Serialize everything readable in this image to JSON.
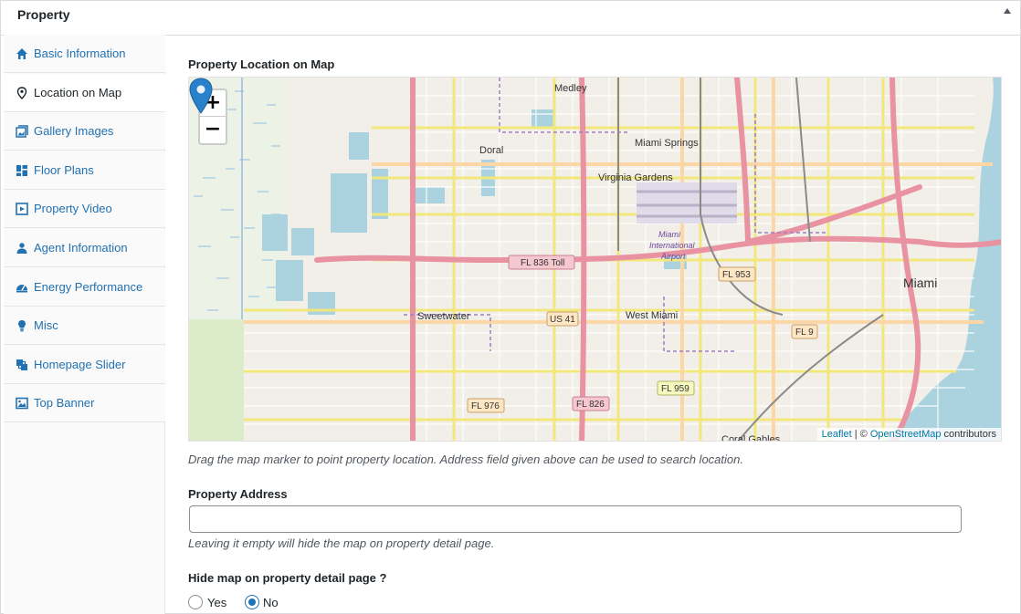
{
  "metabox": {
    "title": "Property"
  },
  "tabs": [
    {
      "label": "Basic Information",
      "icon": "home-icon"
    },
    {
      "label": "Location on Map",
      "icon": "map-pin-icon",
      "active": true
    },
    {
      "label": "Gallery Images",
      "icon": "gallery-icon"
    },
    {
      "label": "Floor Plans",
      "icon": "floor-plan-icon"
    },
    {
      "label": "Property Video",
      "icon": "video-icon"
    },
    {
      "label": "Agent Information",
      "icon": "agent-icon"
    },
    {
      "label": "Energy Performance",
      "icon": "dashboard-icon"
    },
    {
      "label": "Misc",
      "icon": "lightbulb-icon"
    },
    {
      "label": "Homepage Slider",
      "icon": "slides-icon"
    },
    {
      "label": "Top Banner",
      "icon": "image-icon"
    }
  ],
  "map_section": {
    "label": "Property Location on Map",
    "zoom_in": "+",
    "zoom_out": "−",
    "attribution": {
      "leaflet": "Leaflet",
      "separator": " | © ",
      "osm": "OpenStreetMap",
      "suffix": " contributors"
    },
    "places": [
      "Medley",
      "Doral",
      "Miami Springs",
      "Virginia Gardens",
      "Miami",
      "International",
      "Airport",
      "Miami",
      "Sweetwater",
      "West Miami",
      "Coral Gables"
    ],
    "road_shields": [
      "FL 836 Toll",
      "FL 953",
      "US 41",
      "FL 9",
      "FL 959",
      "FL 976",
      "FL 826"
    ],
    "help": "Drag the map marker to point property location. Address field given above can be used to search location."
  },
  "address": {
    "label": "Property Address",
    "value": "",
    "help": "Leaving it empty will hide the map on property detail page."
  },
  "hide_map": {
    "label": "Hide map on property detail page ?",
    "options": [
      {
        "label": "Yes",
        "checked": false
      },
      {
        "label": "No",
        "checked": true
      }
    ]
  },
  "colors": {
    "accent": "#2271b1",
    "marker": "#2a81cb",
    "water": "#aad3df",
    "major_road": "#e892a2",
    "secondary_road": "#f7fabf"
  }
}
